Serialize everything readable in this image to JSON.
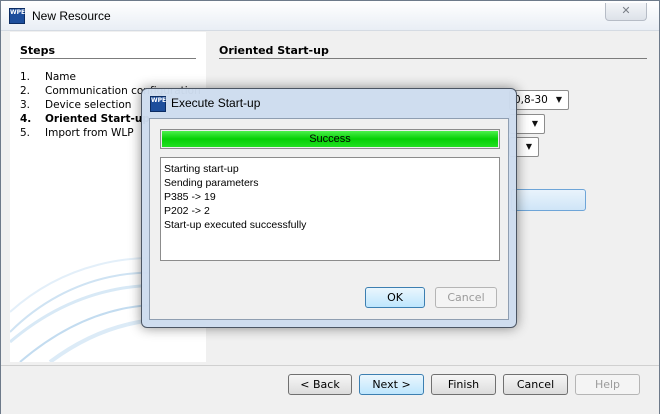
{
  "window": {
    "title": "New Resource",
    "icon_name": "wpe-app-icon",
    "icon_text": "WPE",
    "close_label": "✕"
  },
  "steps": {
    "heading": "Steps",
    "items": [
      {
        "num": "1.",
        "label": "Name"
      },
      {
        "num": "2.",
        "label": "Communication configuration"
      },
      {
        "num": "3.",
        "label": "Device selection"
      },
      {
        "num": "4.",
        "label": "Oriented Start-up"
      },
      {
        "num": "5.",
        "label": "Import from WLP"
      }
    ],
    "active_index": 3
  },
  "panel": {
    "heading": "Oriented Start-up",
    "combo1_value": "0,8-30",
    "combo_arrow": "▼"
  },
  "buttons": {
    "back": "< Back",
    "next": "Next >",
    "finish": "Finish",
    "cancel": "Cancel",
    "help": "Help"
  },
  "dialog": {
    "title": "Execute Start-up",
    "icon_name": "wpe-app-icon",
    "icon_text": "WPE",
    "progress": {
      "label": "Success",
      "value": 1.0,
      "color": "#06d006"
    },
    "log_lines": [
      "Starting start-up",
      "Sending parameters",
      "P385 -> 19",
      "P202 -> 2",
      "Start-up executed successfully"
    ],
    "ok": "OK",
    "cancel": "Cancel"
  }
}
